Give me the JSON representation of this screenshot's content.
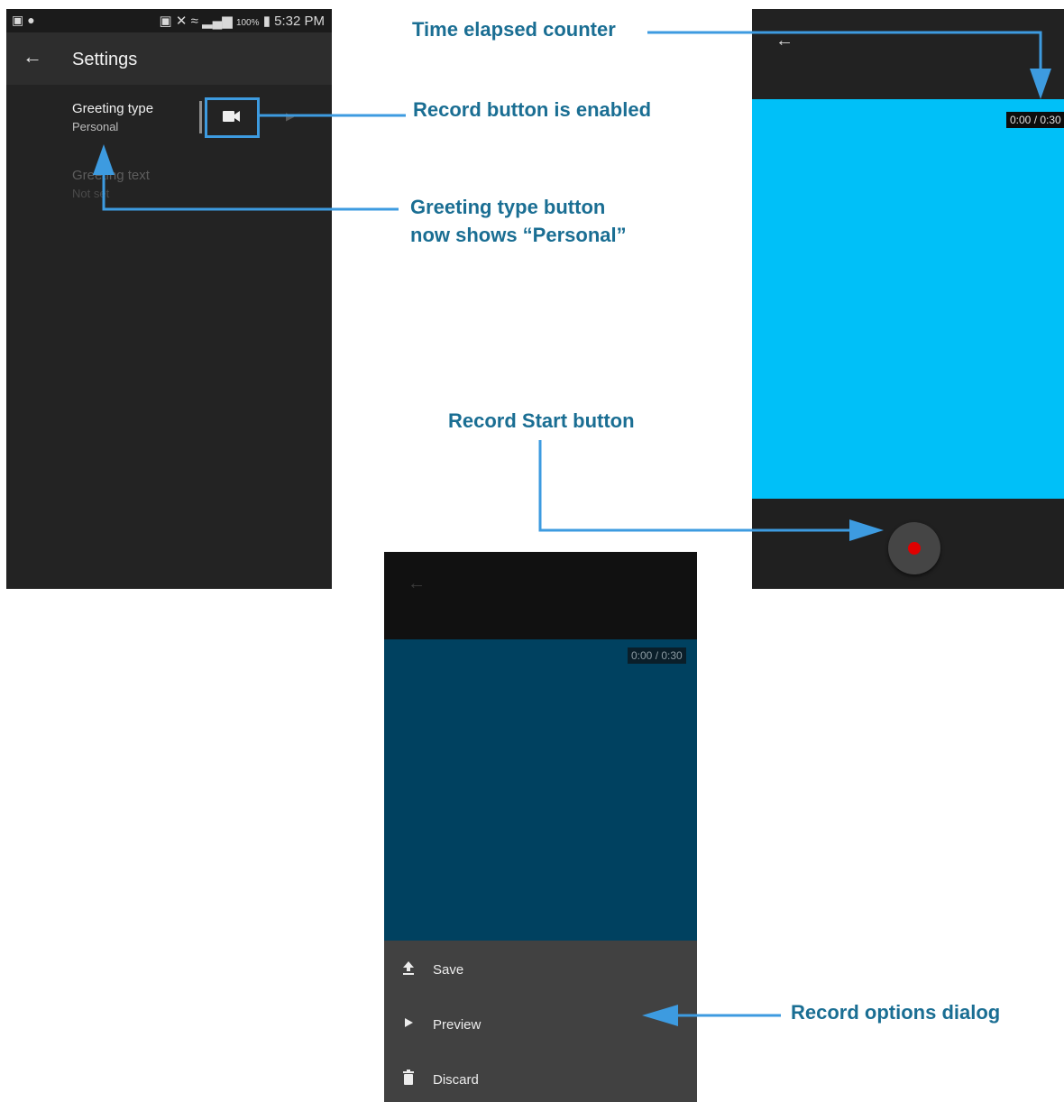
{
  "settings_screen": {
    "status_bar": {
      "left_icons": [
        "gallery-icon",
        "sync-icon"
      ],
      "signal_text": "100%",
      "time": "5:32 PM"
    },
    "title": "Settings",
    "rows": [
      {
        "title": "Greeting type",
        "subtitle": "Personal",
        "enabled": true
      },
      {
        "title": "Greeting text",
        "subtitle": "Not set",
        "enabled": false
      }
    ],
    "record_icon": "video-camera-icon"
  },
  "recorder_screen": {
    "counter": "0:00 / 0:30",
    "record_button_color": "#e00000",
    "preview_color": "#00c0f8"
  },
  "options_screen": {
    "counter": "0:00 / 0:30",
    "options": [
      {
        "label": "Save",
        "icon": "upload-icon"
      },
      {
        "label": "Preview",
        "icon": "play-icon"
      },
      {
        "label": "Discard",
        "icon": "trash-icon"
      }
    ]
  },
  "annotations": {
    "time_elapsed": "Time elapsed counter",
    "record_enabled": "Record button is enabled",
    "greeting_type_line1": "Greeting type button",
    "greeting_type_line2": "now shows “Personal”",
    "record_start": "Record Start button",
    "record_options": "Record options dialog"
  },
  "colors": {
    "annotation_text": "#1a6e93",
    "callout_arrow": "#3d9be0"
  }
}
